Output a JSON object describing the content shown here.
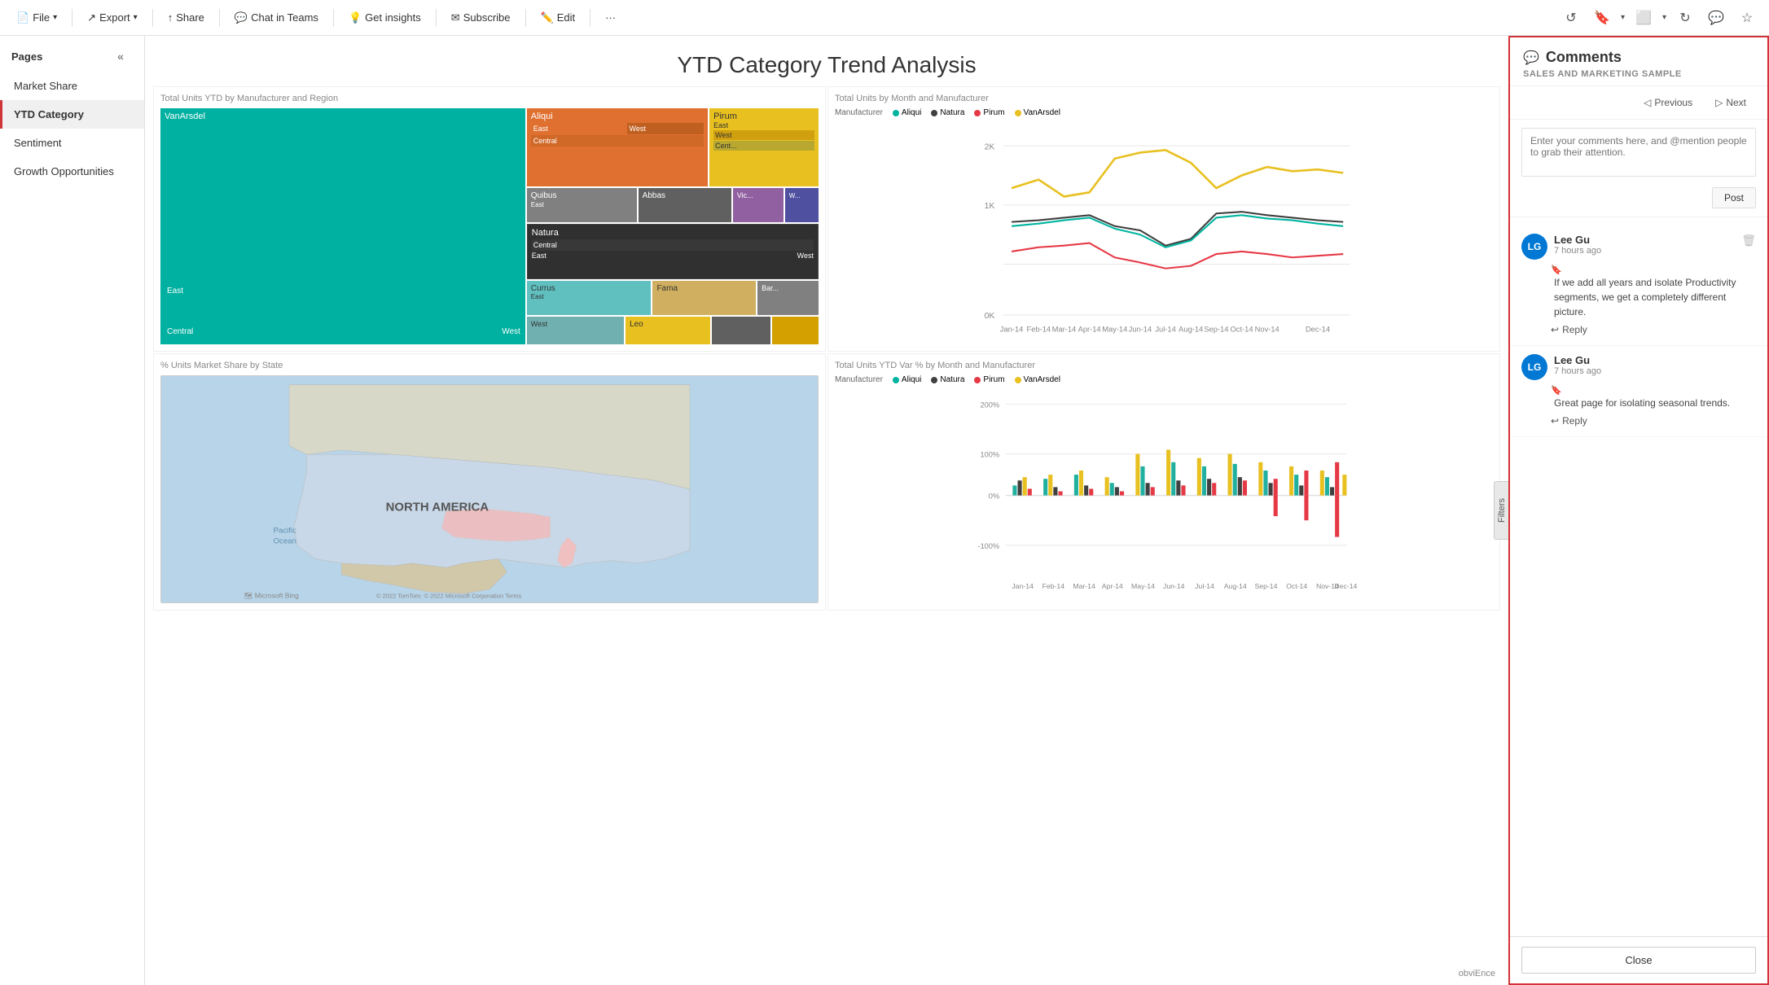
{
  "toolbar": {
    "file_label": "File",
    "export_label": "Export",
    "share_label": "Share",
    "chat_teams_label": "Chat in Teams",
    "insights_label": "Get insights",
    "subscribe_label": "Subscribe",
    "edit_label": "Edit",
    "more_label": "···"
  },
  "sidebar": {
    "pages_label": "Pages",
    "items": [
      {
        "id": "market-share",
        "label": "Market Share",
        "active": false
      },
      {
        "id": "ytd-category",
        "label": "YTD Category",
        "active": true
      },
      {
        "id": "sentiment",
        "label": "Sentiment",
        "active": false
      },
      {
        "id": "growth-opportunities",
        "label": "Growth Opportunities",
        "active": false
      }
    ]
  },
  "report": {
    "title": "YTD Category Trend Analysis",
    "chart1_title": "Total Units YTD by Manufacturer and Region",
    "chart2_title": "Total Units by Month and Manufacturer",
    "chart3_title": "% Units Market Share by State",
    "chart4_title": "Total Units YTD Var % by Month and Manufacturer",
    "filters_label": "Filters",
    "manufacturer_label": "Manufacturer",
    "legend_aliqui": "Aliqui",
    "legend_natura": "Natura",
    "legend_pirum": "Pirum",
    "legend_vanarsdel": "VanArsdel",
    "map_label": "NORTH AMERICA",
    "pacific_label": "Pacific\nOcean",
    "map_credit": "© 2022 TomTom. © 2022 Microsoft Corporation  Terms",
    "bing_credit": "Microsoft Bing",
    "obvience_label": "obviEnce"
  },
  "comments": {
    "panel_title": "Comments",
    "subtitle": "SALES AND MARKETING SAMPLE",
    "prev_label": "Previous",
    "next_label": "Next",
    "input_placeholder": "Enter your comments here, and @mention people to grab their attention.",
    "post_label": "Post",
    "close_label": "Close",
    "comment1": {
      "author": "Lee Gu",
      "time": "7 hours ago",
      "text": "If we add all years and isolate Productivity segments, we get a completely different picture.",
      "reply_label": "Reply"
    },
    "comment2": {
      "author": "Lee Gu",
      "time": "7 hours ago",
      "text": "Great page for isolating seasonal trends.",
      "reply_label": "Reply"
    }
  },
  "colors": {
    "vanarsdel": "#00b4a0",
    "aliqui_red": "#e63946",
    "aliqui_orange": "#e07030",
    "pirum_yellow": "#e8c020",
    "natura_dark": "#404040",
    "quibus": "#808080",
    "currus": "#60c0c0",
    "fama": "#d0b060",
    "bar_teal": "#20b0a0",
    "bar_yellow": "#e8c020",
    "bar_dark": "#404040",
    "bar_red": "#e63946",
    "line_yellow": "#e8c020",
    "line_teal": "#00b4a0",
    "line_dark": "#404040",
    "line_red": "#e63946",
    "accent_red": "#d13438"
  }
}
